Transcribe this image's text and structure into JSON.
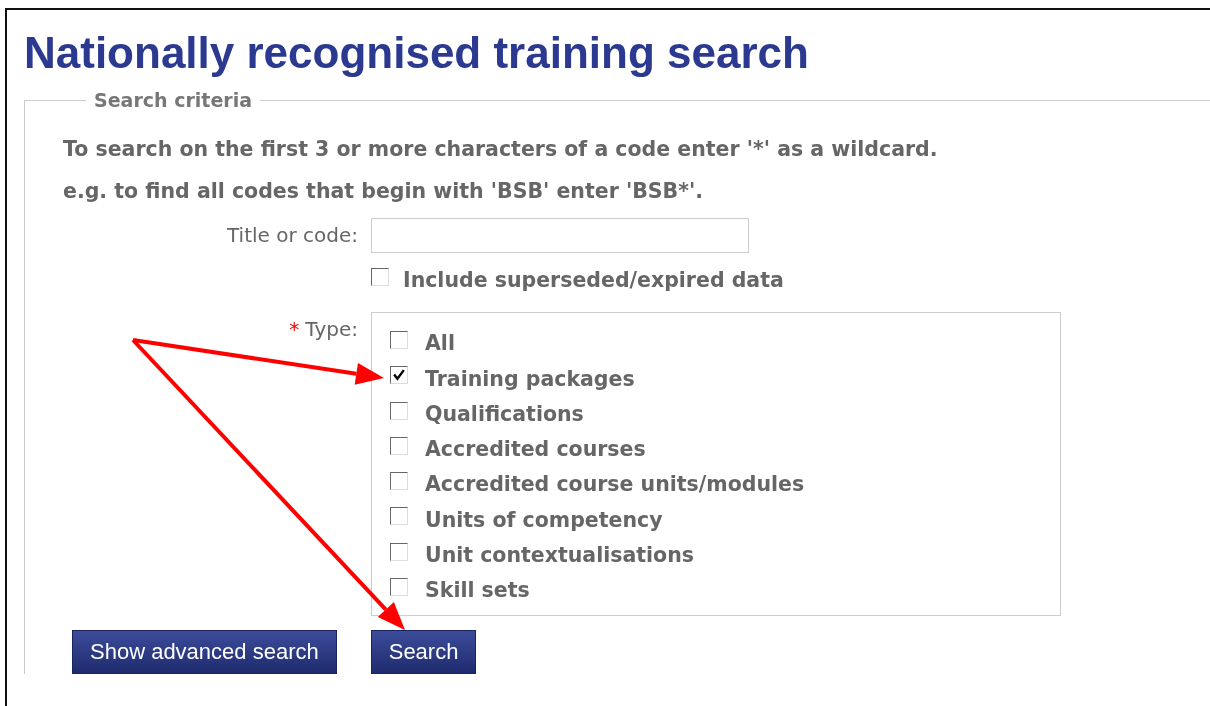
{
  "page": {
    "title": "Nationally recognised training search"
  },
  "search_criteria": {
    "legend": "Search criteria",
    "hints": [
      "To search on the first 3 or more characters of a code enter '*' as a wildcard.",
      "e.g. to find all codes that begin with 'BSB' enter 'BSB*'."
    ],
    "title_or_code": {
      "label": "Title or code:"
    },
    "include_superseded": {
      "label": "Include superseded/expired data",
      "checked": false
    },
    "type": {
      "required_mark": "*",
      "label": "Type:",
      "options": [
        {
          "label": "All",
          "checked": false
        },
        {
          "label": "Training packages",
          "checked": true
        },
        {
          "label": "Qualifications",
          "checked": false
        },
        {
          "label": "Accredited courses",
          "checked": false
        },
        {
          "label": "Accredited course units/modules",
          "checked": false
        },
        {
          "label": "Units of competency",
          "checked": false
        },
        {
          "label": "Unit contextualisations",
          "checked": false
        },
        {
          "label": "Skill sets",
          "checked": false
        }
      ]
    }
  },
  "buttons": [
    {
      "label": "Show advanced search"
    },
    {
      "label": "Search"
    }
  ]
}
